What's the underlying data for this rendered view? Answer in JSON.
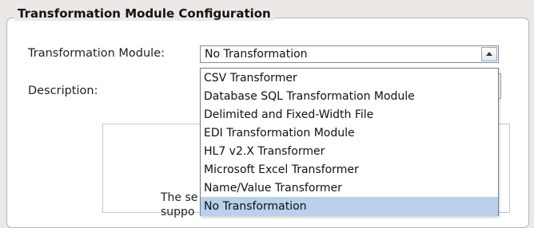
{
  "section": {
    "title": "Transformation Module Configuration"
  },
  "form": {
    "module_label": "Transformation Module:",
    "module_value": "No Transformation",
    "description_label": "Description:"
  },
  "dropdown": {
    "options": [
      "CSV Transformer",
      "Database SQL Transformation Module",
      "Delimited and Fixed-Width File",
      "EDI Transformation Module",
      "HL7 v2.X Transformer",
      "Microsoft Excel Transformer",
      "Name/Value Transformer",
      "No Transformation"
    ],
    "selected_index": 7
  },
  "info": {
    "line1_partial": "The se",
    "line2_partial": "suppo"
  }
}
